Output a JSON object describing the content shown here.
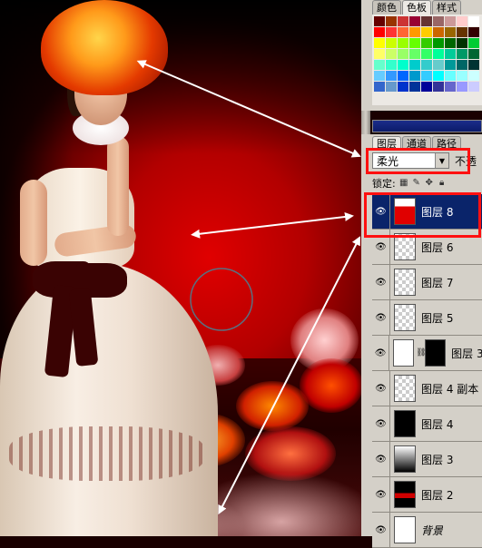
{
  "swatches_panel": {
    "tabs": [
      "颜色",
      "色板",
      "样式"
    ],
    "active_tab": "色板",
    "colors": [
      "#660000",
      "#993300",
      "#cc3333",
      "#990033",
      "#663333",
      "#996666",
      "#cc9999",
      "#ffcccc",
      "#ffffff",
      "#ff0000",
      "#ff3333",
      "#ff6633",
      "#ff9900",
      "#ffcc00",
      "#cc6600",
      "#996600",
      "#663300",
      "#330000",
      "#ffff00",
      "#ccff00",
      "#99ff00",
      "#66ff00",
      "#33cc00",
      "#009900",
      "#006600",
      "#003300",
      "#00cc33",
      "#ffff66",
      "#ccff66",
      "#99ff66",
      "#66ff66",
      "#33ff66",
      "#00ff99",
      "#00cc99",
      "#009966",
      "#006633",
      "#66ffcc",
      "#33ffcc",
      "#00ffcc",
      "#00cccc",
      "#33cccc",
      "#66cccc",
      "#009999",
      "#006666",
      "#003333",
      "#66ccff",
      "#3399ff",
      "#0066ff",
      "#0099cc",
      "#33ccff",
      "#00ffff",
      "#66ffff",
      "#99ffff",
      "#ccffff",
      "#3366cc",
      "#6699cc",
      "#0033cc",
      "#003399",
      "#000099",
      "#333399",
      "#6666cc",
      "#9999ff",
      "#ccccff"
    ]
  },
  "layers_panel": {
    "tabs": [
      "图层",
      "通道",
      "路径"
    ],
    "active_tab": "图层",
    "blend_mode": "柔光",
    "opacity_label": "不透",
    "lock_label": "锁定:",
    "layers": [
      {
        "name": "图层 8",
        "thumb": "red",
        "selected": true
      },
      {
        "name": "图层 6",
        "thumb": "checker",
        "selected": false
      },
      {
        "name": "图层 7",
        "thumb": "checker",
        "selected": false
      },
      {
        "name": "图层 5",
        "thumb": "checker",
        "selected": false
      },
      {
        "name": "图层 3",
        "thumb": "person",
        "mask": true,
        "selected": false
      },
      {
        "name": "图层 4 副本",
        "thumb": "checker",
        "selected": false
      },
      {
        "name": "图层 4",
        "thumb": "black",
        "selected": false
      },
      {
        "name": "图层 3",
        "thumb": "gradient",
        "selected": false
      },
      {
        "name": "图层 2",
        "thumb": "redline",
        "selected": false
      },
      {
        "name": "背景",
        "thumb": "person",
        "selected": false,
        "italic": true
      }
    ]
  },
  "icons": {
    "eye": "eye-icon",
    "link": "chain-link-icon",
    "dropdown": "chevron-down-icon",
    "lock_transparency": "checkerboard-lock-icon",
    "lock_brush": "brush-lock-icon",
    "lock_move": "move-lock-icon",
    "lock_all": "padlock-icon"
  },
  "colors": {
    "highlight": "#ff1010",
    "selection": "#0a246a",
    "panel_bg": "#d4d0c8"
  }
}
